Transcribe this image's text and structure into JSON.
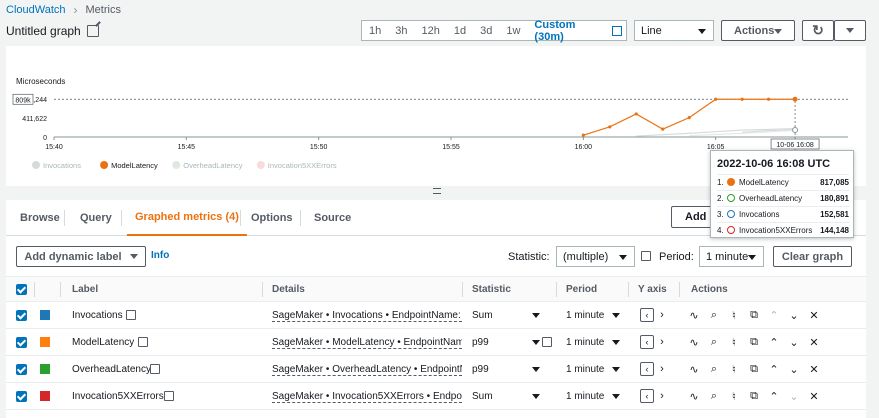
{
  "breadcrumb": {
    "root": "CloudWatch",
    "current": "Metrics"
  },
  "graph_title": "Untitled graph",
  "time_ranges": [
    "1h",
    "3h",
    "12h",
    "1d",
    "3d",
    "1w"
  ],
  "custom_range": "Custom (30m)",
  "chart_type_select": "Line",
  "actions_label": "Actions",
  "colors": {
    "accent": "#ec7211",
    "link": "#0073bb",
    "invocations": "#1f77b4",
    "model_latency": "#ff7f0e",
    "overhead_latency": "#2ca02c",
    "errors": "#d62728"
  },
  "chart_data": {
    "type": "line",
    "ylabel": "Microseconds",
    "y_ticks": [
      "823,244",
      "411,622",
      "0"
    ],
    "cursor_y_label": "809k",
    "x_ticks": [
      "15:40",
      "15:45",
      "15:50",
      "15:55",
      "16:00",
      "16:05"
    ],
    "cursor_x_label": "10-06 16:08",
    "ylim": [
      0,
      823244
    ],
    "x_range_minutes": [
      0,
      30
    ],
    "legend_position": "bottom-left",
    "series": [
      {
        "name": "Invocations",
        "x": [
          26,
          27,
          28
        ],
        "values": [
          100000,
          140000,
          152581
        ]
      },
      {
        "name": "ModelLatency",
        "x": [
          20,
          21,
          22,
          23,
          24,
          25,
          26,
          27,
          28
        ],
        "values": [
          40000,
          220000,
          500000,
          170000,
          420000,
          817085,
          817085,
          817085,
          817085
        ]
      },
      {
        "name": "OverheadLatency",
        "x": [
          22,
          24,
          26,
          28
        ],
        "values": [
          20000,
          80000,
          150000,
          180891
        ]
      },
      {
        "name": "Invocation5XXErrors",
        "x": [
          24,
          26,
          28
        ],
        "values": [
          30000,
          80000,
          144148
        ]
      }
    ]
  },
  "tabs": [
    "Browse",
    "Query",
    "Graphed metrics (4)",
    "Options",
    "Source"
  ],
  "add_button": "Add m",
  "controls": {
    "dynamic_label": "Add dynamic label",
    "info": "Info",
    "statistic_label": "Statistic:",
    "statistic_value": "(multiple)",
    "period_label": "Period:",
    "period_value": "1 minute",
    "clear": "Clear graph"
  },
  "table": {
    "headers": [
      "Label",
      "Details",
      "Statistic",
      "Period",
      "Y axis",
      "Actions"
    ],
    "rows": [
      {
        "label": "Invocations",
        "details": "SageMaker • Invocations • EndpointName: hu",
        "statistic": "Sum",
        "period": "1 minute",
        "color": "#1f77b4"
      },
      {
        "label": "ModelLatency",
        "details": "SageMaker • ModelLatency • EndpointName:",
        "statistic": "p99",
        "period": "1 minute",
        "color": "#ff7f0e"
      },
      {
        "label": "OverheadLatency",
        "details": "SageMaker • OverheadLatency • EndpointNar",
        "statistic": "p99",
        "period": "1 minute",
        "color": "#2ca02c"
      },
      {
        "label": "Invocation5XXErrors",
        "details": "SageMaker • Invocation5XXErrors • Endpoint",
        "statistic": "Sum",
        "period": "1 minute",
        "color": "#d62728"
      }
    ]
  },
  "tooltip": {
    "time": "2022-10-06 16:08 UTC",
    "rows": [
      {
        "num": "1.",
        "name": "ModelLatency",
        "value": "817,085",
        "filled": true,
        "color": "#ec7211"
      },
      {
        "num": "2.",
        "name": "OverheadLatency",
        "value": "180,891",
        "filled": false,
        "color": "#2ca02c"
      },
      {
        "num": "3.",
        "name": "Invocations",
        "value": "152,581",
        "filled": false,
        "color": "#1f77b4"
      },
      {
        "num": "4.",
        "name": "Invocation5XXErrors",
        "value": "144,148",
        "filled": false,
        "color": "#d62728"
      }
    ]
  }
}
